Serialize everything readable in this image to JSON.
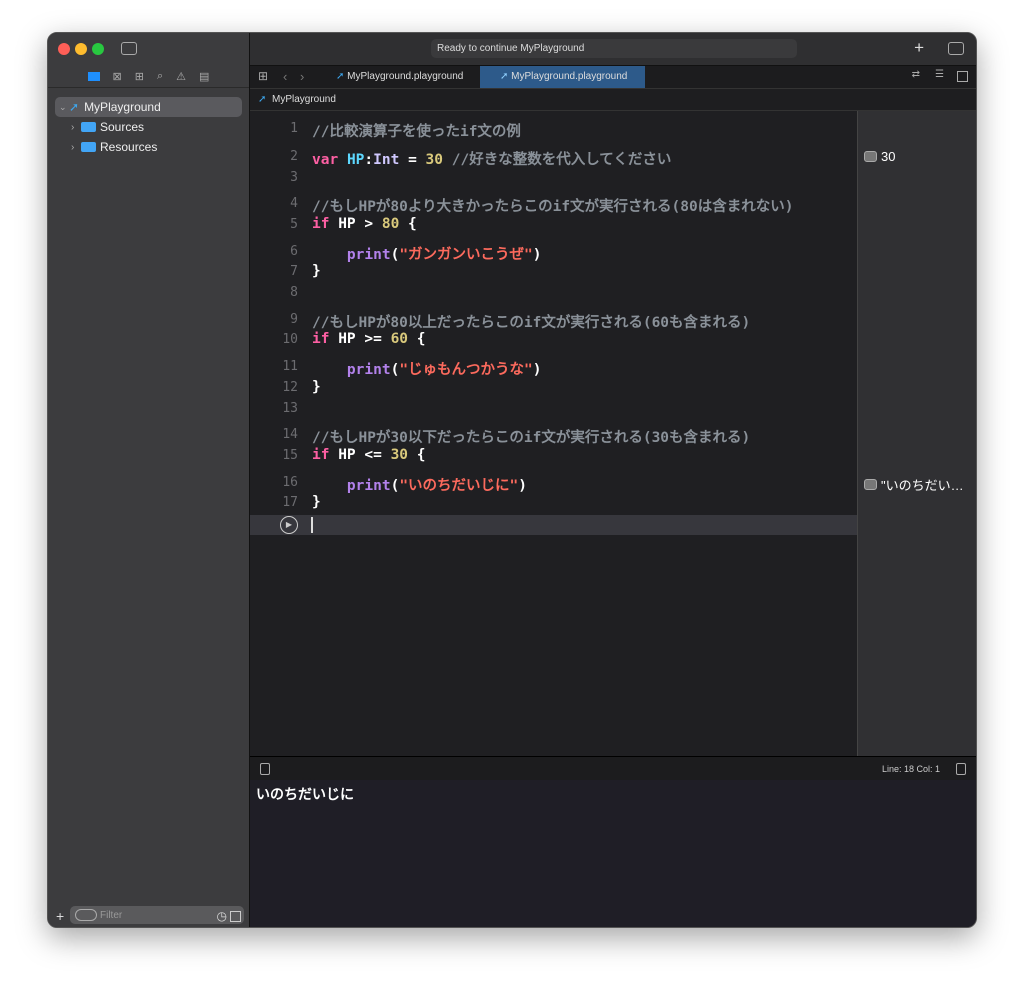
{
  "window": {
    "status": "Ready to continue MyPlayground"
  },
  "sidebar": {
    "tree": [
      {
        "label": "MyPlayground",
        "expanded": true,
        "selected": true
      },
      {
        "label": "Sources"
      },
      {
        "label": "Resources"
      }
    ],
    "filter_placeholder": "Filter"
  },
  "tabs": [
    {
      "label": "MyPlayground.playground",
      "active": false
    },
    {
      "label": "MyPlayground.playground",
      "active": true
    }
  ],
  "breadcrumb": "MyPlayground",
  "code": [
    [
      [
        "comment",
        "//比較演算子を使ったif文の例"
      ]
    ],
    [
      [
        "kw",
        "var"
      ],
      [
        "plain",
        " "
      ],
      [
        "ident",
        "HP"
      ],
      [
        "plain",
        ":"
      ],
      [
        "type",
        "Int"
      ],
      [
        "plain",
        " = "
      ],
      [
        "num",
        "30"
      ],
      [
        "comment",
        " //好きな整数を代入してください"
      ]
    ],
    [],
    [
      [
        "comment",
        "//もしHPが80より大きかったらこのif文が実行される(80は含まれない)"
      ]
    ],
    [
      [
        "kw",
        "if"
      ],
      [
        "plain",
        " HP > "
      ],
      [
        "num",
        "80"
      ],
      [
        "plain",
        " {"
      ]
    ],
    [
      [
        "plain",
        "    "
      ],
      [
        "fn",
        "print"
      ],
      [
        "plain",
        "("
      ],
      [
        "str",
        "\"ガンガンいこうぜ\""
      ],
      [
        "plain",
        ")"
      ]
    ],
    [
      [
        "plain",
        "}"
      ]
    ],
    [],
    [
      [
        "comment",
        "//もしHPが80以上だったらこのif文が実行される(60も含まれる)"
      ]
    ],
    [
      [
        "kw",
        "if"
      ],
      [
        "plain",
        " HP >= "
      ],
      [
        "num",
        "60"
      ],
      [
        "plain",
        " {"
      ]
    ],
    [
      [
        "plain",
        "    "
      ],
      [
        "fn",
        "print"
      ],
      [
        "plain",
        "("
      ],
      [
        "str",
        "\"じゅもんつかうな\""
      ],
      [
        "plain",
        ")"
      ]
    ],
    [
      [
        "plain",
        "}"
      ]
    ],
    [],
    [
      [
        "comment",
        "//もしHPが30以下だったらこのif文が実行される(30も含まれる)"
      ]
    ],
    [
      [
        "kw",
        "if"
      ],
      [
        "plain",
        " HP <= "
      ],
      [
        "num",
        "30"
      ],
      [
        "plain",
        " {"
      ]
    ],
    [
      [
        "plain",
        "    "
      ],
      [
        "fn",
        "print"
      ],
      [
        "plain",
        "("
      ],
      [
        "str",
        "\"いのちだいじに\""
      ],
      [
        "plain",
        ")"
      ]
    ],
    [
      [
        "plain",
        "}"
      ]
    ]
  ],
  "results": [
    {
      "line": 2,
      "text": "30"
    },
    {
      "line": 16,
      "text": "\"いのちだい…"
    }
  ],
  "status_bar": {
    "position": "Line: 18  Col: 1"
  },
  "console": {
    "output": "いのちだいじに"
  },
  "colors": {
    "keyword": "#fc5fa3",
    "string": "#fc6a5d",
    "number": "#d9c97c",
    "comment": "#8a9199",
    "function": "#b281eb",
    "active_tab": "#2d5a8a"
  }
}
